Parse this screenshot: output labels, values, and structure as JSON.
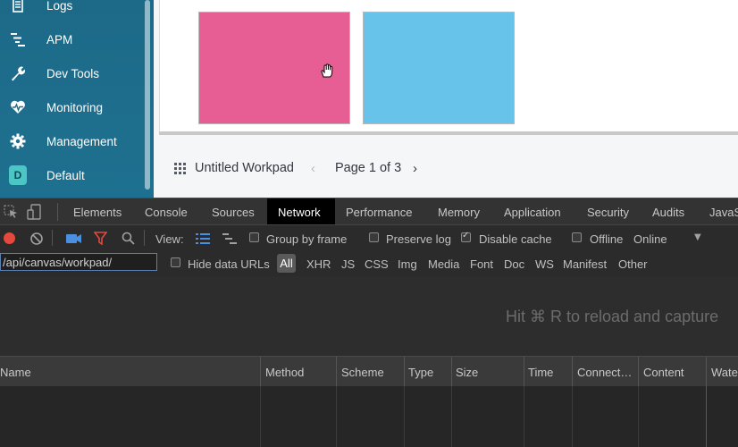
{
  "sidebar": {
    "items": [
      {
        "label": "Logs",
        "icon": "logs-icon"
      },
      {
        "label": "APM",
        "icon": "apm-icon"
      },
      {
        "label": "Dev Tools",
        "icon": "wrench-icon"
      },
      {
        "label": "Monitoring",
        "icon": "heartbeat-icon"
      },
      {
        "label": "Management",
        "icon": "gear-icon"
      },
      {
        "label": "Default",
        "icon": "space-avatar",
        "avatar_letter": "D"
      }
    ]
  },
  "workpad": {
    "title": "Untitled Workpad",
    "page_label": "Page 1 of 3",
    "prev": "‹",
    "next": "›",
    "colors": {
      "pink": "#e65e93",
      "blue": "#67c3ea"
    }
  },
  "devtools": {
    "tabs": [
      "Elements",
      "Console",
      "Sources",
      "Network",
      "Performance",
      "Memory",
      "Application",
      "Security",
      "Audits",
      "JavaS"
    ],
    "active_tab": "Network",
    "toolbar": {
      "view_label": "View:",
      "group_by_frame": "Group by frame",
      "preserve_log": "Preserve log",
      "disable_cache": "Disable cache",
      "offline": "Offline",
      "throttle": "Online",
      "throttle_arrow": "▼"
    },
    "filter": {
      "value": "/api/canvas/workpad/",
      "hide_data_urls": "Hide data URLs",
      "types": [
        "All",
        "XHR",
        "JS",
        "CSS",
        "Img",
        "Media",
        "Font",
        "Doc",
        "WS",
        "Manifest",
        "Other"
      ]
    },
    "hint": "Hit ⌘ R to reload and capture",
    "columns": [
      "Name",
      "Method",
      "Scheme",
      "Type",
      "Size",
      "Time",
      "Connect…",
      "Content",
      "Wate"
    ]
  }
}
